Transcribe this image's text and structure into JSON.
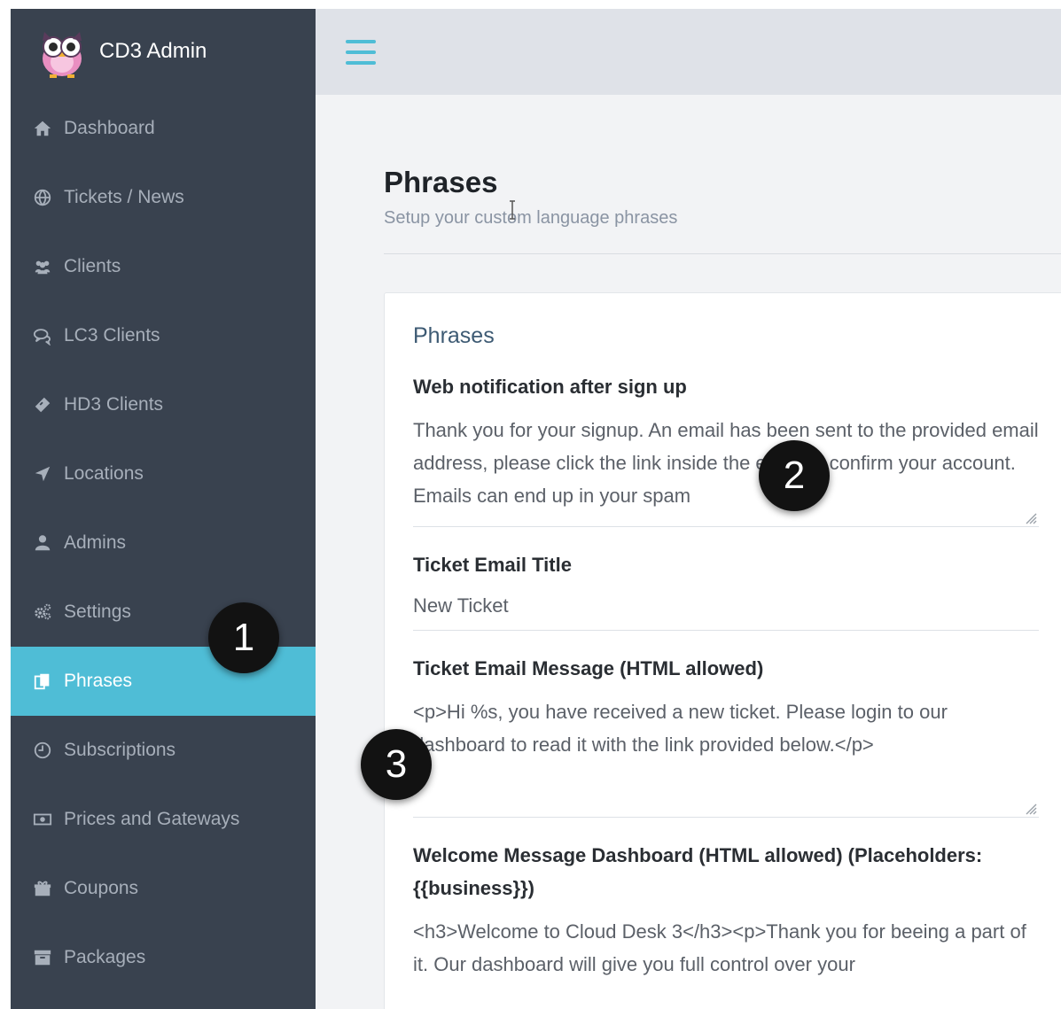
{
  "sidebar": {
    "brand": "CD3 Admin",
    "items": [
      {
        "label": "Dashboard",
        "icon": "home-icon"
      },
      {
        "label": "Tickets / News",
        "icon": "globe-icon"
      },
      {
        "label": "Clients",
        "icon": "users-icon"
      },
      {
        "label": "LC3 Clients",
        "icon": "chat-icon"
      },
      {
        "label": "HD3 Clients",
        "icon": "ticket-icon"
      },
      {
        "label": "Locations",
        "icon": "location-arrow-icon"
      },
      {
        "label": "Admins",
        "icon": "user-icon"
      },
      {
        "label": "Settings",
        "icon": "gears-icon"
      },
      {
        "label": "Phrases",
        "icon": "copy-icon",
        "active": true
      },
      {
        "label": "Subscriptions",
        "icon": "clock-icon"
      },
      {
        "label": "Prices and Gateways",
        "icon": "money-icon"
      },
      {
        "label": "Coupons",
        "icon": "gift-icon"
      },
      {
        "label": "Packages",
        "icon": "archive-icon"
      }
    ],
    "active_color": "#4fbdd6",
    "background_color": "#39424f"
  },
  "header": {
    "title": "Phrases",
    "subtitle": "Setup your custom language phrases"
  },
  "card": {
    "title": "Phrases",
    "fields": [
      {
        "label": "Web notification after sign up",
        "value": "Thank you for your signup. An email has been sent to the provided email address, please click the link inside the email to confirm your account. Emails can end up in your spam"
      },
      {
        "label": "Ticket Email Title",
        "value": "New Ticket"
      },
      {
        "label": "Ticket Email Message (HTML allowed)",
        "value": "<p>Hi %s, you have received a new ticket. Please login to our dashboard to read it with the link provided below.</p>"
      },
      {
        "label": "Welcome Message Dashboard (HTML allowed) (Placeholders: {{business}})",
        "value": "<h3>Welcome to Cloud Desk 3</h3><p>Thank you for beeing a part of it. Our dashboard will give you full control over your"
      }
    ]
  },
  "callouts": {
    "one": "1",
    "two": "2",
    "three": "3"
  }
}
